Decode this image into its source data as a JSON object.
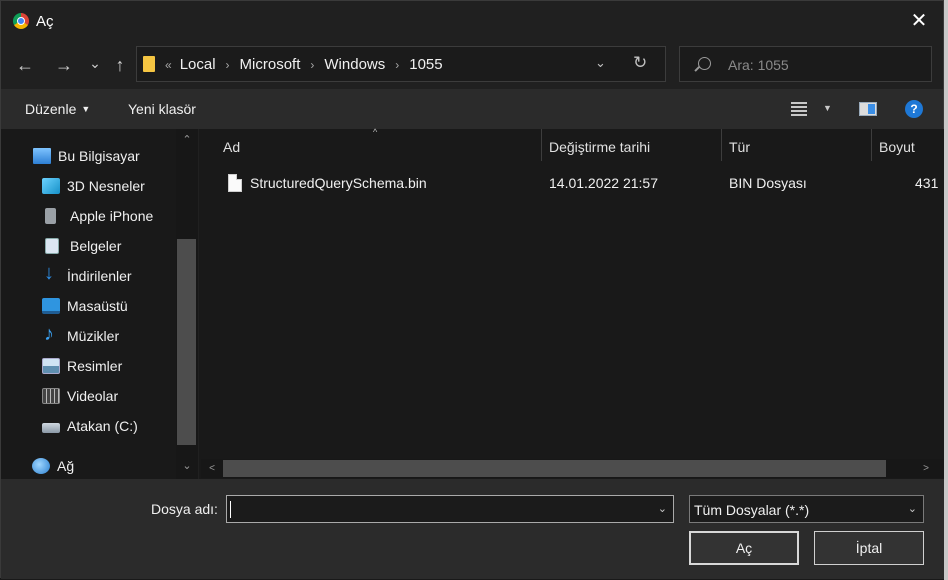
{
  "window": {
    "title": "Aç",
    "close_glyph": "✕"
  },
  "nav": {
    "back_glyph": "←",
    "forward_glyph": "→",
    "recent_glyph": "⌄",
    "up_glyph": "↑",
    "breadcrumb_lead": "«",
    "breadcrumb": [
      "Local",
      "Microsoft",
      "Windows",
      "1055"
    ],
    "breadcrumb_sep": "›",
    "dropdown_glyph": "⌄",
    "refresh_glyph": "↻"
  },
  "search": {
    "placeholder": "Ara: 1055",
    "value": ""
  },
  "toolbar": {
    "organize_label": "Düzenle",
    "organize_caret": "▼",
    "new_folder_label": "Yeni klasör",
    "view_caret": "▼",
    "help_glyph": "?"
  },
  "sidebar": {
    "items": [
      {
        "label": "Bu Bilgisayar",
        "icon": "this-pc-icon"
      },
      {
        "label": "3D Nesneler",
        "icon": "3d-objects-icon"
      },
      {
        "label": "Apple iPhone",
        "icon": "phone-icon"
      },
      {
        "label": "Belgeler",
        "icon": "documents-icon"
      },
      {
        "label": "İndirilenler",
        "icon": "downloads-icon"
      },
      {
        "label": "Masaüstü",
        "icon": "desktop-icon"
      },
      {
        "label": "Müzikler",
        "icon": "music-icon"
      },
      {
        "label": "Resimler",
        "icon": "pictures-icon"
      },
      {
        "label": "Videolar",
        "icon": "videos-icon"
      },
      {
        "label": "Atakan (C:)",
        "icon": "drive-icon"
      },
      {
        "label": "Ağ",
        "icon": "network-icon"
      }
    ],
    "scroll_up": "⌃",
    "scroll_down": "⌄"
  },
  "filelist": {
    "columns": [
      "Ad",
      "Değiştirme tarihi",
      "Tür",
      "Boyut"
    ],
    "sort_caret": "^",
    "rows": [
      {
        "name": "StructuredQuerySchema.bin",
        "modified": "14.01.2022 21:57",
        "type": "BIN Dosyası",
        "size": "431"
      }
    ],
    "scroll_left": "<",
    "scroll_right": ">"
  },
  "footer": {
    "filename_label": "Dosya adı:",
    "filename_value": "",
    "filename_dd": "⌄",
    "filetype_value": "Tüm Dosyalar (*.*)",
    "filetype_dd": "⌄",
    "open_label": "Aç",
    "cancel_label": "İptal"
  }
}
